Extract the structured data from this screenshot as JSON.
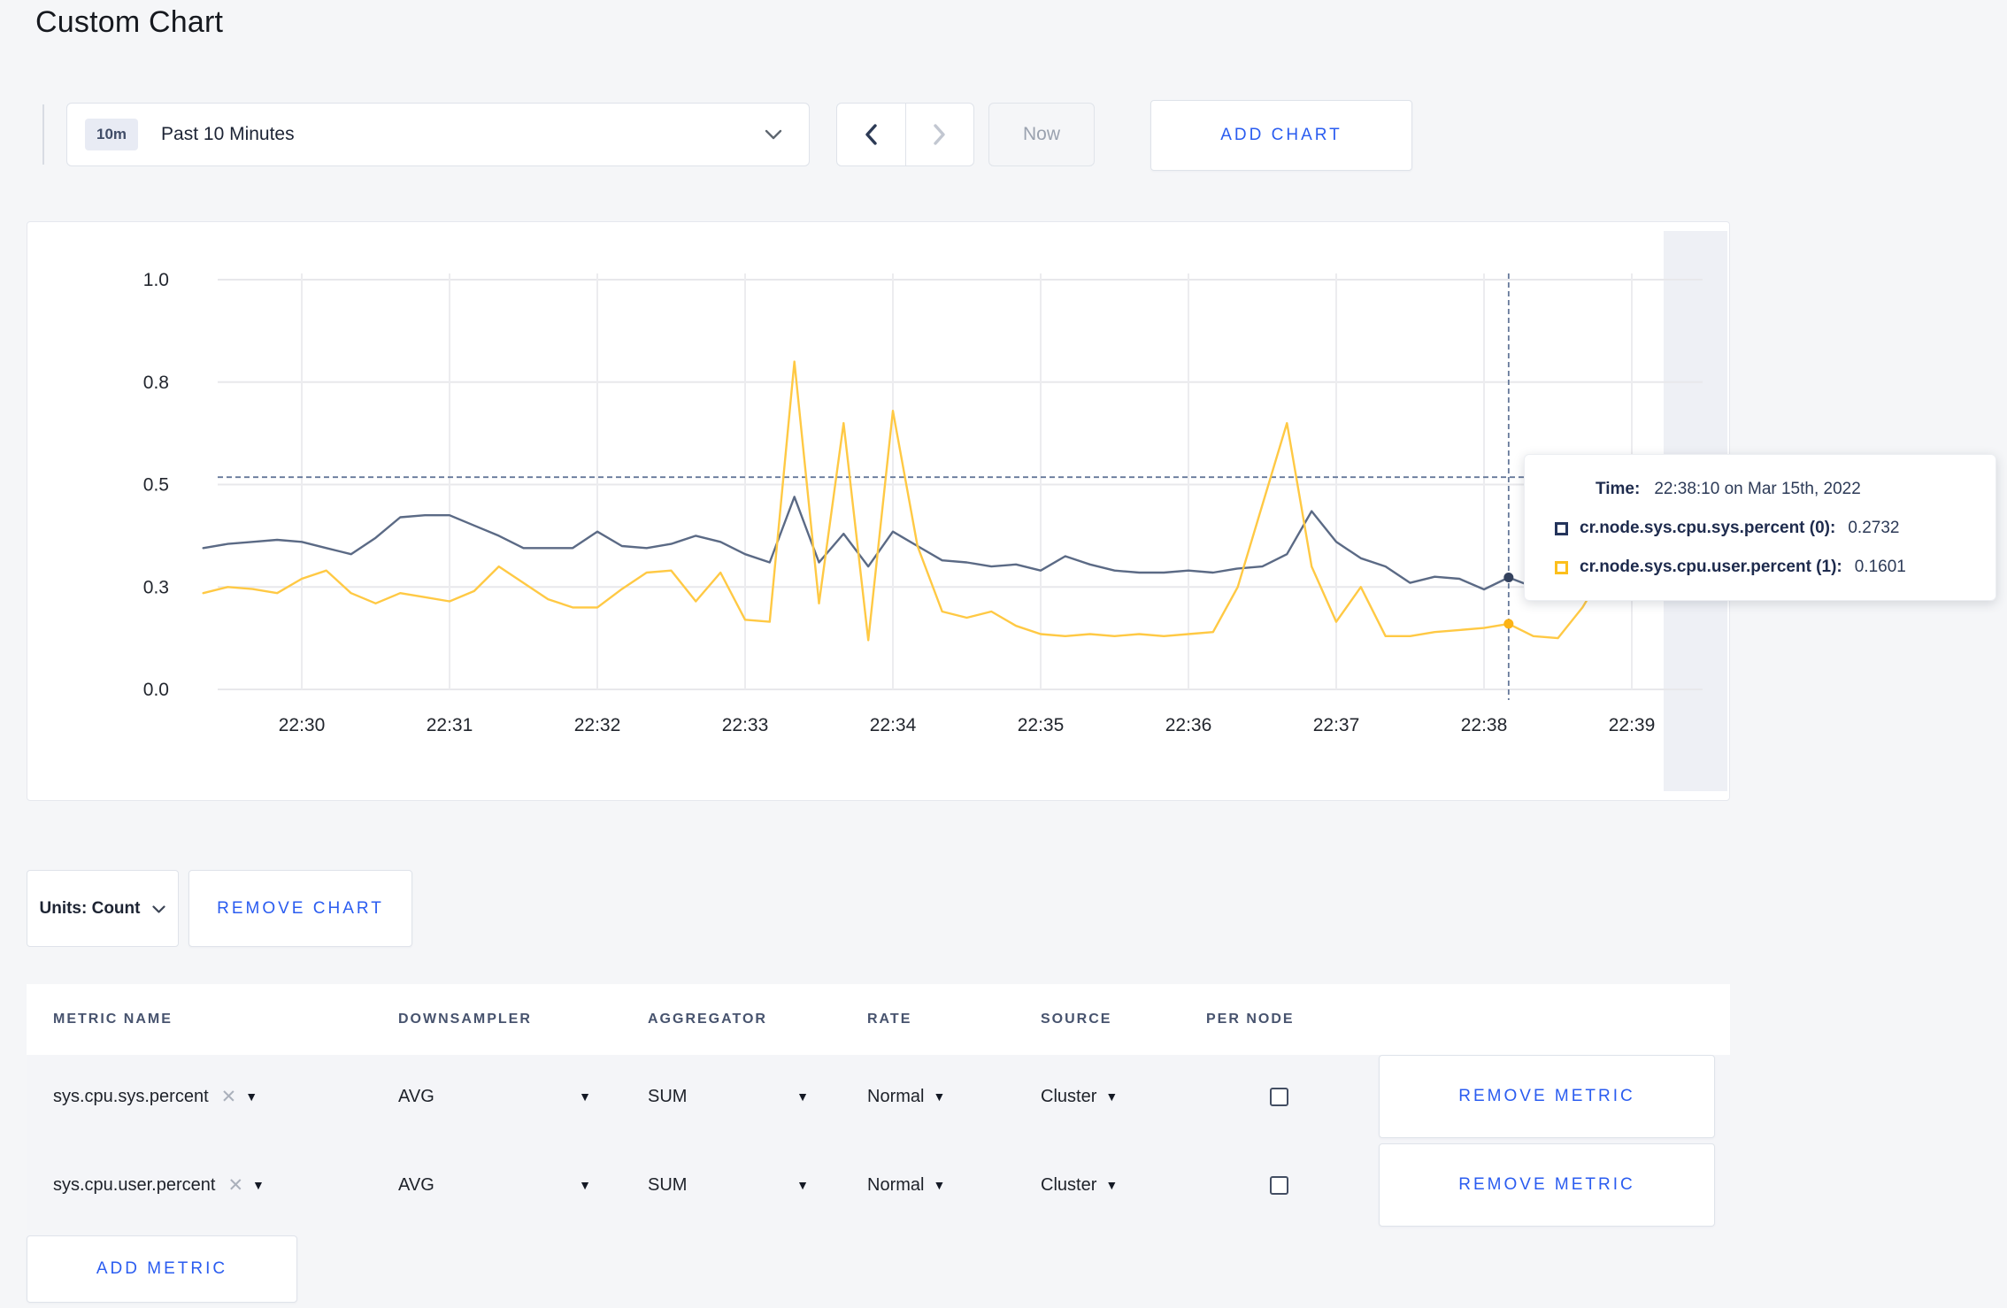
{
  "header": {
    "title": "Custom Chart"
  },
  "controls": {
    "time_badge": "10m",
    "time_label": "Past 10 Minutes",
    "now_label": "Now",
    "add_chart_label": "ADD CHART"
  },
  "tooltip": {
    "time_label": "Time:",
    "time_value": "22:38:10 on Mar 15th, 2022",
    "rows": [
      {
        "label": "cr.node.sys.cpu.sys.percent (0):",
        "value": "0.2732",
        "color": "#24345b"
      },
      {
        "label": "cr.node.sys.cpu.user.percent (1):",
        "value": "0.1601",
        "color": "#fcbf1c"
      }
    ]
  },
  "units": {
    "label": "Units: Count",
    "remove_chart_label": "REMOVE CHART"
  },
  "table": {
    "headers": [
      "METRIC NAME",
      "DOWNSAMPLER",
      "AGGREGATOR",
      "RATE",
      "SOURCE",
      "PER NODE"
    ],
    "rows": [
      {
        "metric": "sys.cpu.sys.percent",
        "downsampler": "AVG",
        "aggregator": "SUM",
        "rate": "Normal",
        "source": "Cluster",
        "per_node": false,
        "remove_label": "REMOVE METRIC"
      },
      {
        "metric": "sys.cpu.user.percent",
        "downsampler": "AVG",
        "aggregator": "SUM",
        "rate": "Normal",
        "source": "Cluster",
        "per_node": false,
        "remove_label": "REMOVE METRIC"
      }
    ],
    "add_metric_label": "ADD METRIC"
  },
  "chart_data": {
    "type": "line",
    "title": "",
    "xlabel": "",
    "ylabel": "",
    "ylim": [
      0,
      1
    ],
    "grid": true,
    "x_ticks": [
      "22:30",
      "22:31",
      "22:32",
      "22:33",
      "22:34",
      "22:35",
      "22:36",
      "22:37",
      "22:38",
      "22:39"
    ],
    "y_ticks": [
      {
        "value": 0,
        "label": "0.0"
      },
      {
        "value": 0.25,
        "label": "0.3"
      },
      {
        "value": 0.5,
        "label": "0.5"
      },
      {
        "value": 0.75,
        "label": "0.8"
      },
      {
        "value": 1.0,
        "label": "1.0"
      }
    ],
    "start_offset_seconds": -40,
    "step_seconds": 10,
    "series": [
      {
        "name": "cr.node.sys.cpu.sys.percent",
        "color": "#5b6a85",
        "dot_color": "#34425e",
        "values": [
          0.345,
          0.355,
          0.36,
          0.365,
          0.36,
          0.345,
          0.33,
          0.37,
          0.42,
          0.425,
          0.425,
          0.4,
          0.375,
          0.345,
          0.345,
          0.345,
          0.385,
          0.35,
          0.345,
          0.355,
          0.375,
          0.36,
          0.33,
          0.31,
          0.47,
          0.31,
          0.38,
          0.3,
          0.385,
          0.35,
          0.315,
          0.31,
          0.3,
          0.305,
          0.29,
          0.325,
          0.305,
          0.29,
          0.285,
          0.285,
          0.29,
          0.285,
          0.295,
          0.3,
          0.33,
          0.435,
          0.36,
          0.32,
          0.3,
          0.26,
          0.275,
          0.27,
          0.244,
          0.2732,
          0.25,
          0.26,
          0.27,
          0.28,
          0.275,
          0.28
        ]
      },
      {
        "name": "cr.node.sys.cpu.user.percent",
        "color": "#ffc944",
        "dot_color": "#fcb315",
        "values": [
          0.235,
          0.25,
          0.245,
          0.235,
          0.27,
          0.29,
          0.235,
          0.21,
          0.235,
          0.225,
          0.215,
          0.24,
          0.3,
          0.26,
          0.22,
          0.2,
          0.2,
          0.245,
          0.285,
          0.29,
          0.215,
          0.285,
          0.17,
          0.165,
          0.8,
          0.21,
          0.65,
          0.12,
          0.68,
          0.35,
          0.19,
          0.175,
          0.19,
          0.155,
          0.135,
          0.13,
          0.135,
          0.13,
          0.135,
          0.13,
          0.135,
          0.14,
          0.25,
          0.45,
          0.65,
          0.3,
          0.165,
          0.25,
          0.13,
          0.13,
          0.14,
          0.145,
          0.15,
          0.1601,
          0.13,
          0.125,
          0.2,
          0.3,
          0.285,
          0.235
        ]
      }
    ],
    "crosshair": {
      "time": "22:38:10",
      "seconds_from_2230": 490,
      "hover_value": 0.518,
      "point_values": [
        0.2732,
        0.1601
      ]
    },
    "colors": {
      "gridline": "#e8e8eb",
      "dashed": "#66799a",
      "band": "#eef0f5",
      "tick_text": "#22262e"
    },
    "legend_position": "tooltip"
  }
}
